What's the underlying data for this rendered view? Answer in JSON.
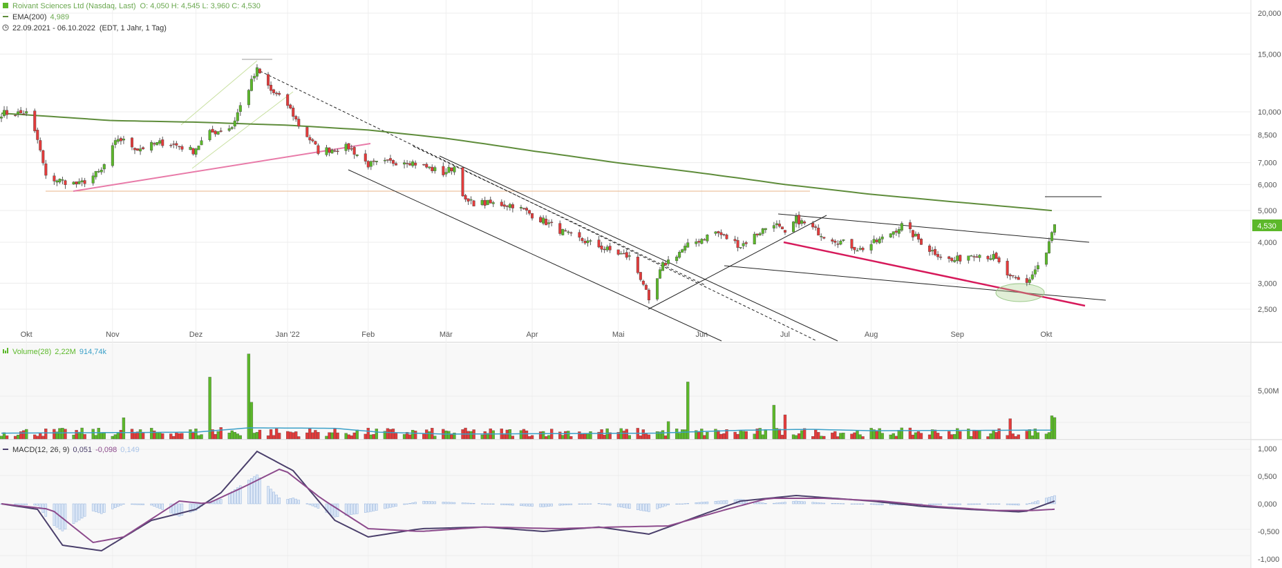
{
  "header": {
    "title": "Roivant Sciences Ltd (Nasdaq, Last)",
    "ohlc": "O: 4,050  H: 4,545  L: 3,960  C: 4,530",
    "ema_label": "EMA(200)",
    "ema_value": "4,989",
    "date_range": "22.09.2021 - 06.10.2022",
    "date_range_note": "(EDT, 1 Jahr, 1 Tag)"
  },
  "price_panel": {
    "y_ticks": [
      "20,000",
      "15,000",
      "10,000",
      "8,500",
      "7,000",
      "6,000",
      "5,000",
      "4,000",
      "3,000",
      "2,500"
    ],
    "last_price_label": "4,530",
    "x_ticks": [
      "Okt",
      "Nov",
      "Dez",
      "Jan '22",
      "Feb",
      "Mär",
      "Apr",
      "Mai",
      "Jun",
      "Jul",
      "Aug",
      "Sep",
      "Okt"
    ]
  },
  "volume_panel": {
    "label": "Volume(28)",
    "value1": "2,22M",
    "value2": "914,74k",
    "y_ticks": [
      "5,00M"
    ]
  },
  "macd_panel": {
    "label": "MACD(12, 26, 9)",
    "value1": "0,051",
    "value2": "-0,098",
    "value3": "0,149",
    "y_ticks": [
      "1,000",
      "0,500",
      "0,000",
      "-0,500",
      "-1,000"
    ]
  },
  "colors": {
    "up": "#5cb82a",
    "down": "#e23b3b",
    "ema": "#5e8c3a",
    "macd": "#4a3f6b",
    "signal": "#8c4a8c",
    "volavg": "#3aa0c8",
    "hist": "#aac4e8",
    "pink": "#e87aa8",
    "red_trend": "#d6195a",
    "orange_line": "#e8b48a"
  },
  "chart_data": {
    "type": "candlestick",
    "x_range": [
      "2021-09-22",
      "2022-10-06"
    ],
    "ylim": [
      2.2,
      20
    ],
    "y_scale": "log",
    "anchors": [
      [
        "2021-09-22",
        9.9
      ],
      [
        "2021-10-01",
        9.9
      ],
      [
        "2021-10-05",
        8.2
      ],
      [
        "2021-10-08",
        6.3
      ],
      [
        "2021-10-20",
        6.0
      ],
      [
        "2021-10-28",
        6.6
      ],
      [
        "2021-11-03",
        8.3
      ],
      [
        "2021-11-10",
        7.7
      ],
      [
        "2021-11-20",
        8.1
      ],
      [
        "2021-11-30",
        7.6
      ],
      [
        "2021-12-06",
        8.6
      ],
      [
        "2021-12-14",
        9.0
      ],
      [
        "2021-12-20",
        11.8
      ],
      [
        "2021-12-23",
        13.4
      ],
      [
        "2021-12-28",
        11.6
      ],
      [
        "2022-01-03",
        10.5
      ],
      [
        "2022-01-07",
        9.1
      ],
      [
        "2022-01-14",
        7.6
      ],
      [
        "2022-01-25",
        7.8
      ],
      [
        "2022-02-01",
        6.9
      ],
      [
        "2022-02-15",
        7.1
      ],
      [
        "2022-02-28",
        6.5
      ],
      [
        "2022-03-04",
        6.8
      ],
      [
        "2022-03-08",
        5.3
      ],
      [
        "2022-03-25",
        5.2
      ],
      [
        "2022-04-04",
        4.7
      ],
      [
        "2022-04-14",
        4.2
      ],
      [
        "2022-04-28",
        3.8
      ],
      [
        "2022-05-06",
        3.6
      ],
      [
        "2022-05-11",
        3.0
      ],
      [
        "2022-05-13",
        2.6
      ],
      [
        "2022-05-18",
        3.4
      ],
      [
        "2022-05-27",
        3.9
      ],
      [
        "2022-06-06",
        4.3
      ],
      [
        "2022-06-15",
        3.9
      ],
      [
        "2022-06-27",
        4.6
      ],
      [
        "2022-07-01",
        4.2
      ],
      [
        "2022-07-05",
        4.7
      ],
      [
        "2022-07-15",
        4.2
      ],
      [
        "2022-07-28",
        3.8
      ],
      [
        "2022-08-05",
        4.1
      ],
      [
        "2022-08-12",
        4.5
      ],
      [
        "2022-08-22",
        3.8
      ],
      [
        "2022-08-30",
        3.5
      ],
      [
        "2022-09-07",
        3.7
      ],
      [
        "2022-09-14",
        3.6
      ],
      [
        "2022-09-20",
        3.1
      ],
      [
        "2022-09-26",
        3.0
      ],
      [
        "2022-09-29",
        3.3
      ],
      [
        "2022-10-03",
        3.7
      ],
      [
        "2022-10-06",
        4.53
      ]
    ],
    "ema200": [
      [
        "2021-09-22",
        9.9
      ],
      [
        "2021-11-01",
        9.4
      ],
      [
        "2021-12-01",
        9.3
      ],
      [
        "2022-01-03",
        9.1
      ],
      [
        "2022-02-01",
        8.8
      ],
      [
        "2022-03-01",
        8.3
      ],
      [
        "2022-04-01",
        7.6
      ],
      [
        "2022-05-01",
        7.0
      ],
      [
        "2022-06-01",
        6.5
      ],
      [
        "2022-07-01",
        6.0
      ],
      [
        "2022-08-01",
        5.6
      ],
      [
        "2022-09-01",
        5.3
      ],
      [
        "2022-10-06",
        4.989
      ]
    ]
  }
}
